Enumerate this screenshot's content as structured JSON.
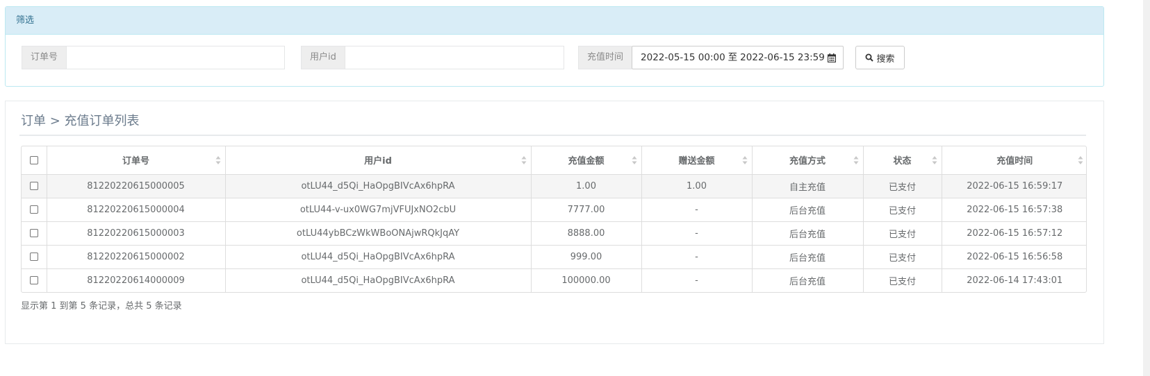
{
  "filter": {
    "heading": "筛选",
    "order_no_label": "订单号",
    "order_no_value": "",
    "user_id_label": "用户id",
    "user_id_value": "",
    "time_label": "充值时间",
    "time_start": "2022-05-15 00:00",
    "time_sep": "至",
    "time_end": "2022-06-15 23:59",
    "search_label": "搜索"
  },
  "list": {
    "breadcrumb": "订单 > 充值订单列表",
    "columns": [
      "订单号",
      "用户id",
      "充值金额",
      "赠送金额",
      "充值方式",
      "状态",
      "充值时间"
    ],
    "rows": [
      {
        "order_no": "81220220615000005",
        "user_id": "otLU44_d5Qi_HaOpgBIVcAx6hpRA",
        "amount": "1.00",
        "bonus": "1.00",
        "method": "自主充值",
        "status": "已支付",
        "time": "2022-06-15 16:59:17"
      },
      {
        "order_no": "81220220615000004",
        "user_id": "otLU44-v-ux0WG7mjVFUJxNO2cbU",
        "amount": "7777.00",
        "bonus": "-",
        "method": "后台充值",
        "status": "已支付",
        "time": "2022-06-15 16:57:38"
      },
      {
        "order_no": "81220220615000003",
        "user_id": "otLU44ybBCzWkWBoONAjwRQkJqAY",
        "amount": "8888.00",
        "bonus": "-",
        "method": "后台充值",
        "status": "已支付",
        "time": "2022-06-15 16:57:12"
      },
      {
        "order_no": "81220220615000002",
        "user_id": "otLU44_d5Qi_HaOpgBIVcAx6hpRA",
        "amount": "999.00",
        "bonus": "-",
        "method": "后台充值",
        "status": "已支付",
        "time": "2022-06-15 16:56:58"
      },
      {
        "order_no": "81220220614000009",
        "user_id": "otLU44_d5Qi_HaOpgBIVcAx6hpRA",
        "amount": "100000.00",
        "bonus": "-",
        "method": "后台充值",
        "status": "已支付",
        "time": "2022-06-14 17:43:01"
      }
    ],
    "footer": "显示第 1 到第 5 条记录，总共 5 条记录"
  },
  "icons": {
    "calendar": "calendar-icon",
    "search": "search-icon",
    "sort": "sort-icon"
  },
  "colors": {
    "filter_heading_bg": "#d9edf7",
    "filter_heading_text": "#31708f",
    "stripe_row": "#f5f5f5"
  }
}
